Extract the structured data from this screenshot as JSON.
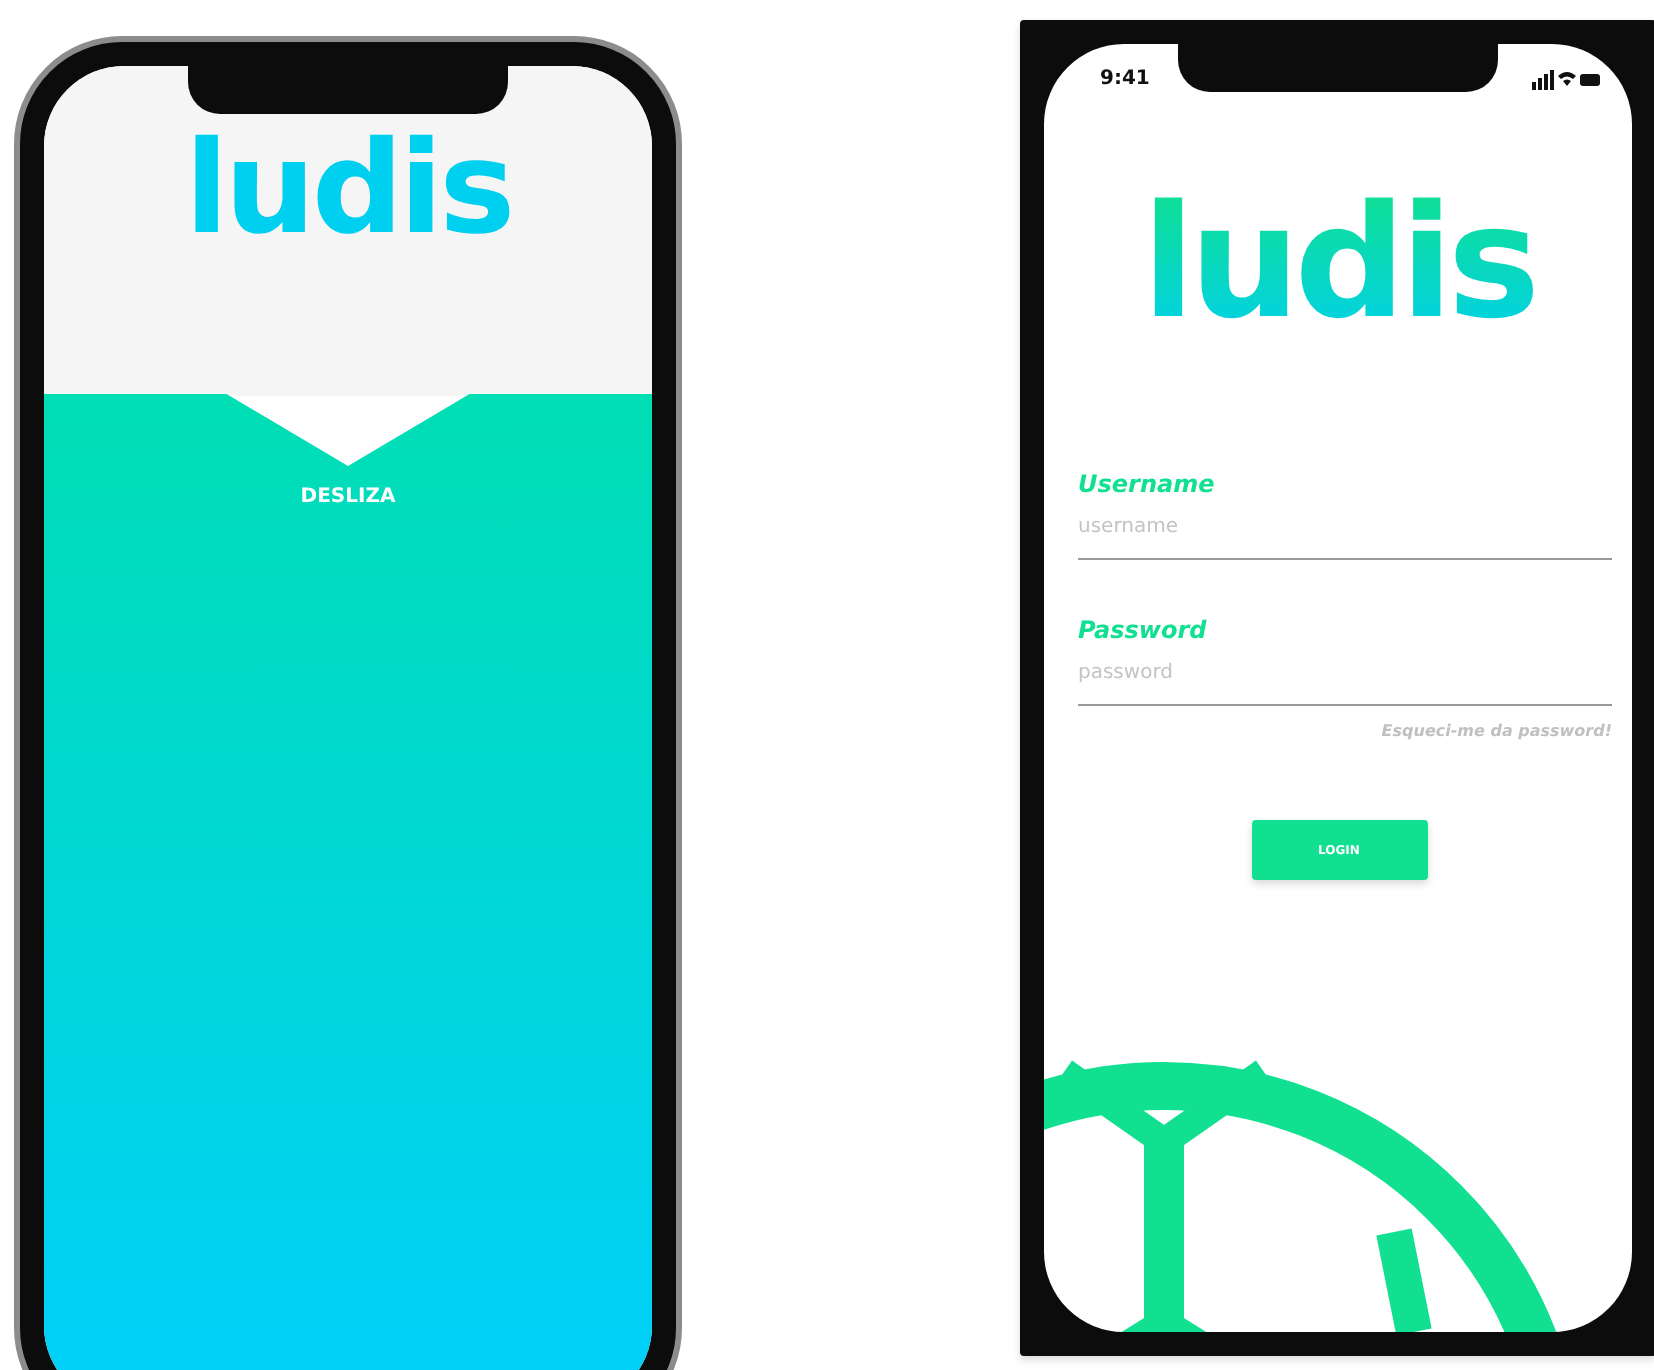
{
  "screens": [
    {
      "kind": "intro",
      "logo": "ludis",
      "swipe_label": "DESLIZA"
    },
    {
      "kind": "login",
      "status_bar": {
        "time": "9:41"
      },
      "logo": "ludis",
      "fields": [
        {
          "label": "Username",
          "placeholder": "username"
        },
        {
          "label": "Password",
          "placeholder": "password"
        }
      ],
      "forgot_link": "Esqueci-me da password!",
      "login_button": "LOGIN"
    }
  ]
}
